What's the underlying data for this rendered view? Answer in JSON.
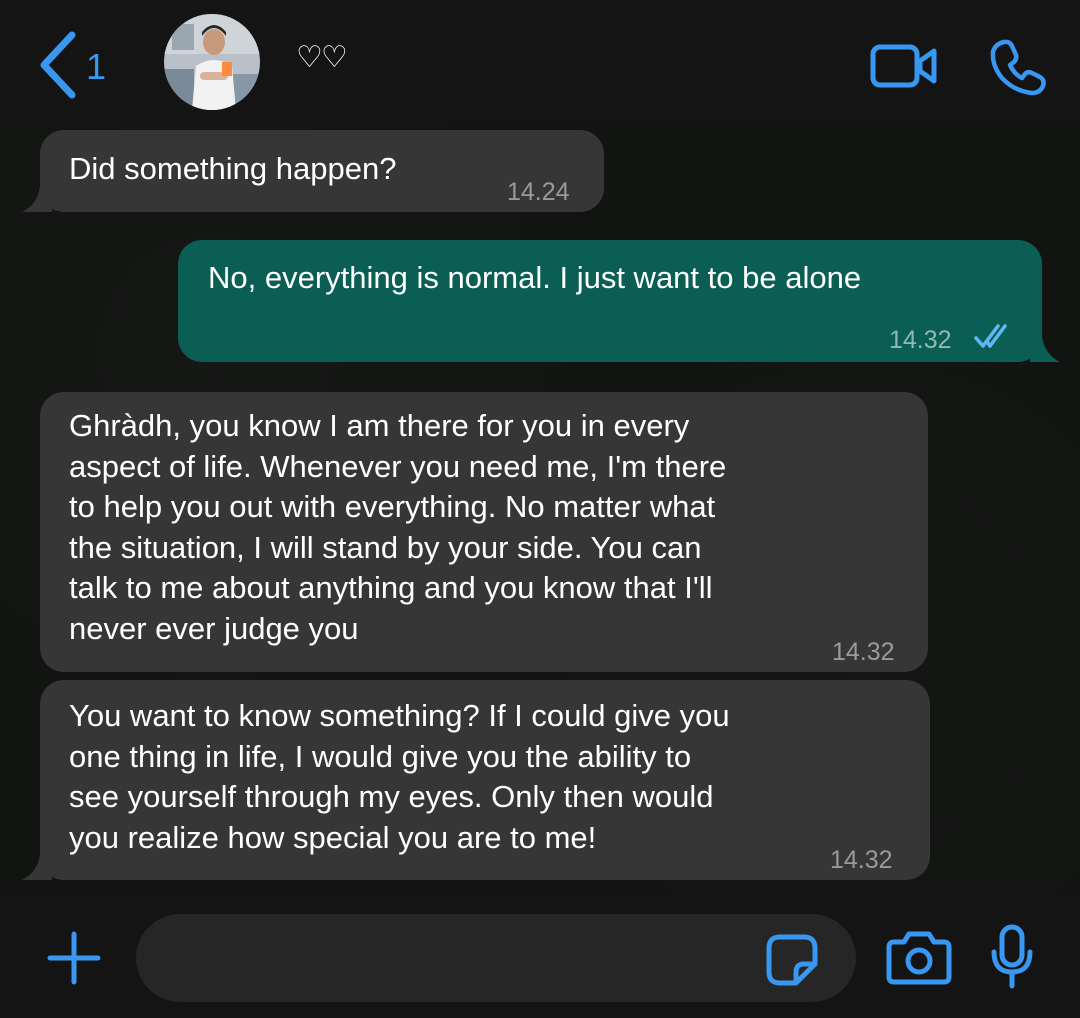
{
  "header": {
    "back_count": "1",
    "contact_name": "♡♡"
  },
  "messages": [
    {
      "direction": "incoming",
      "text": "Did something happen?",
      "time": "14.24"
    },
    {
      "direction": "outgoing",
      "text": "No, everything is normal. I just want to be alone",
      "time": "14.32",
      "status": "read"
    },
    {
      "direction": "incoming",
      "text": "Ghràdh, you know I am there for you in every\naspect of life. Whenever you need me, I'm there\nto help you out with everything. No matter what\nthe situation, I will stand by your side. You can\ntalk to me about anything and you know that I'll\nnever ever judge you",
      "time": "14.32"
    },
    {
      "direction": "incoming",
      "text": "You want to know something? If I could give you\none thing in life, I would give you the ability to\nsee yourself through my eyes. Only then would\nyou realize how special you are to me!",
      "time": "14.32"
    }
  ],
  "composer": {
    "placeholder": "",
    "value": ""
  },
  "icons": {
    "back": "chevron-left-icon",
    "video": "video-camera-icon",
    "call": "phone-icon",
    "attach": "plus-icon",
    "sticker": "sticker-icon",
    "camera": "camera-icon",
    "mic": "microphone-icon"
  },
  "colors": {
    "accent": "#3897f0",
    "outgoing_bubble": "#0b5e54",
    "incoming_bubble": "#363636",
    "read_ticks": "#5fb8f5"
  }
}
